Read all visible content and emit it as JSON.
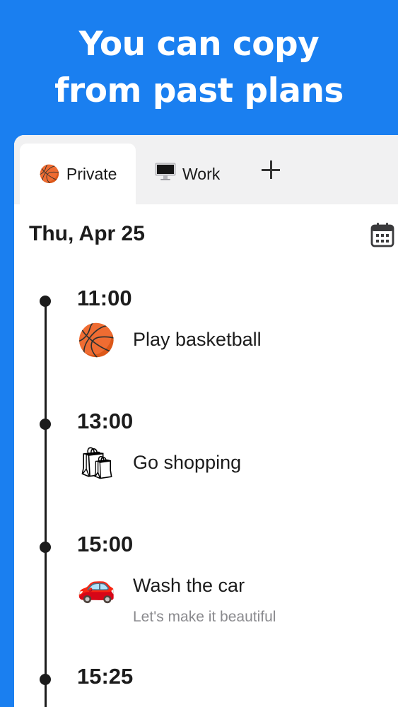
{
  "headline": {
    "line1": "You can copy",
    "line2": "from past plans"
  },
  "tabs": [
    {
      "emoji": "🏀",
      "label": "Private",
      "active": true
    },
    {
      "emoji": "🖥",
      "label": "Work",
      "active": false
    }
  ],
  "add_tab_icon": "plus-icon",
  "date": "Thu, Apr 25",
  "calendar_icon": "calendar-icon",
  "entries": [
    {
      "time": "11:00",
      "emoji": "🏀",
      "title": "Play basketball",
      "note": ""
    },
    {
      "time": "13:00",
      "emoji": "🛍",
      "title": "Go shopping",
      "note": ""
    },
    {
      "time": "15:00",
      "emoji": "🚗",
      "title": "Wash the car",
      "note": "Let's make it beautiful"
    },
    {
      "time": "15:25",
      "emoji": "",
      "title": "",
      "note": ""
    }
  ],
  "colors": {
    "background": "#1a7ff0",
    "card": "#ffffff",
    "tabbar": "#f1f1f2",
    "timeline": "#1c1c1c",
    "note": "#8a8a8e"
  }
}
